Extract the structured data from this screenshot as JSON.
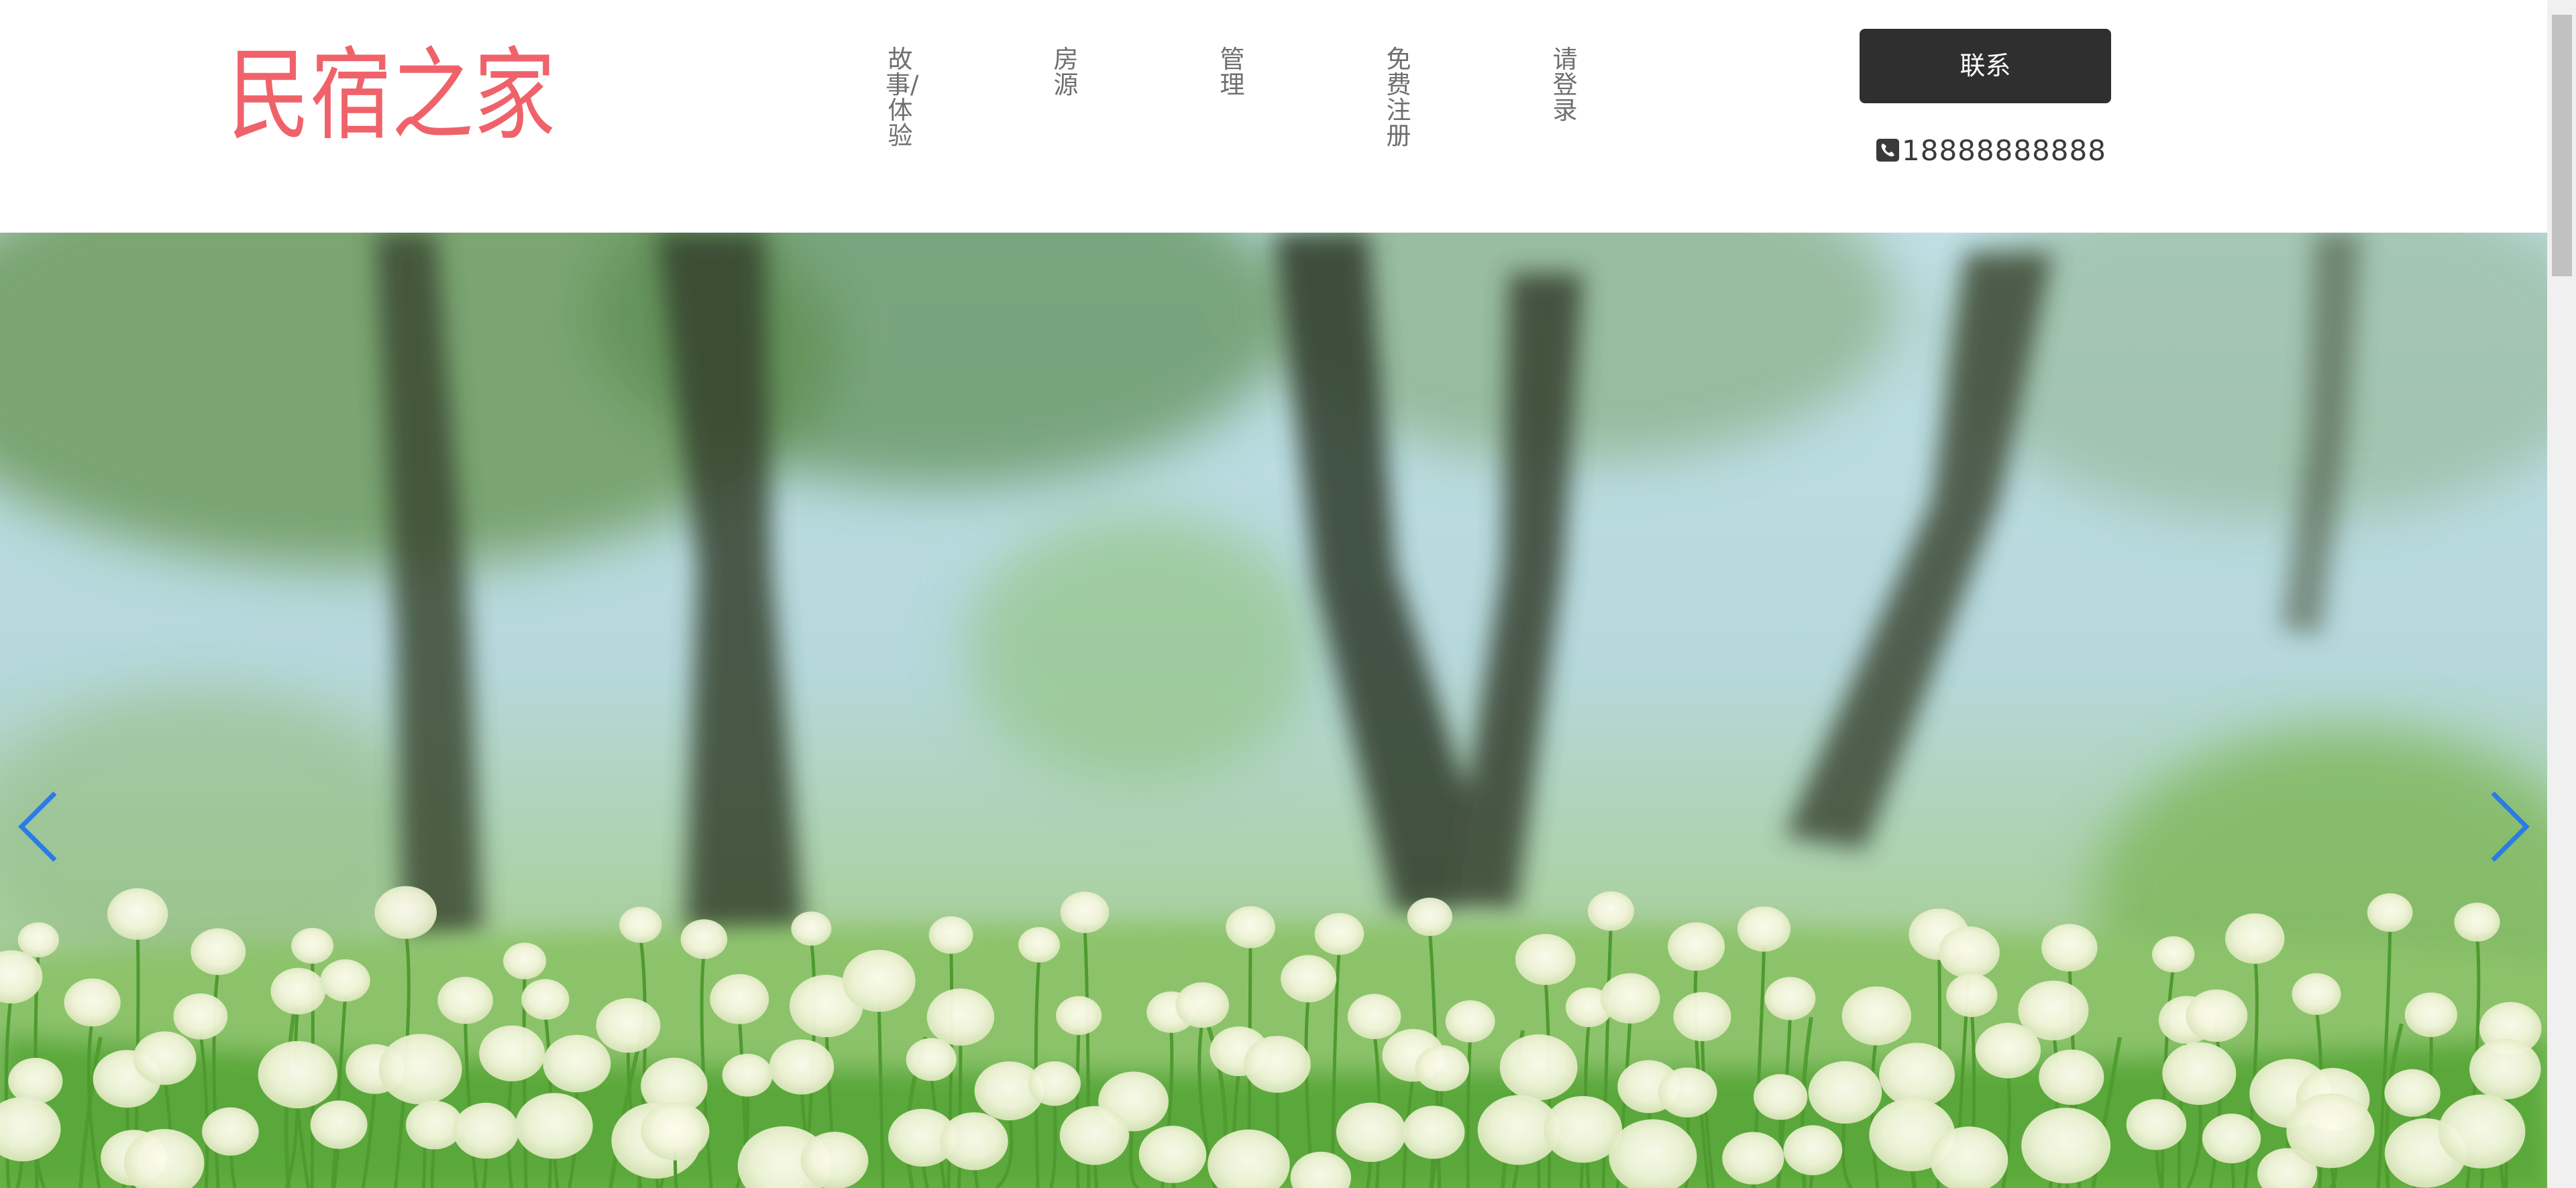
{
  "header": {
    "logo_text": "民宿之家",
    "nav": [
      {
        "label": "故事/体验"
      },
      {
        "label": "房源"
      },
      {
        "label": "管理"
      },
      {
        "label": "免费注册"
      },
      {
        "label": "请登录"
      }
    ],
    "contact_label": "联系",
    "phone": "18888888888"
  },
  "carousel": {
    "prev_icon": "chevron-left-icon",
    "next_icon": "chevron-right-icon"
  },
  "colors": {
    "logo": "#f0626a",
    "nav_text": "#6f6f6f",
    "button_bg": "#2f2f2f",
    "arrow": "#2c7be5"
  }
}
